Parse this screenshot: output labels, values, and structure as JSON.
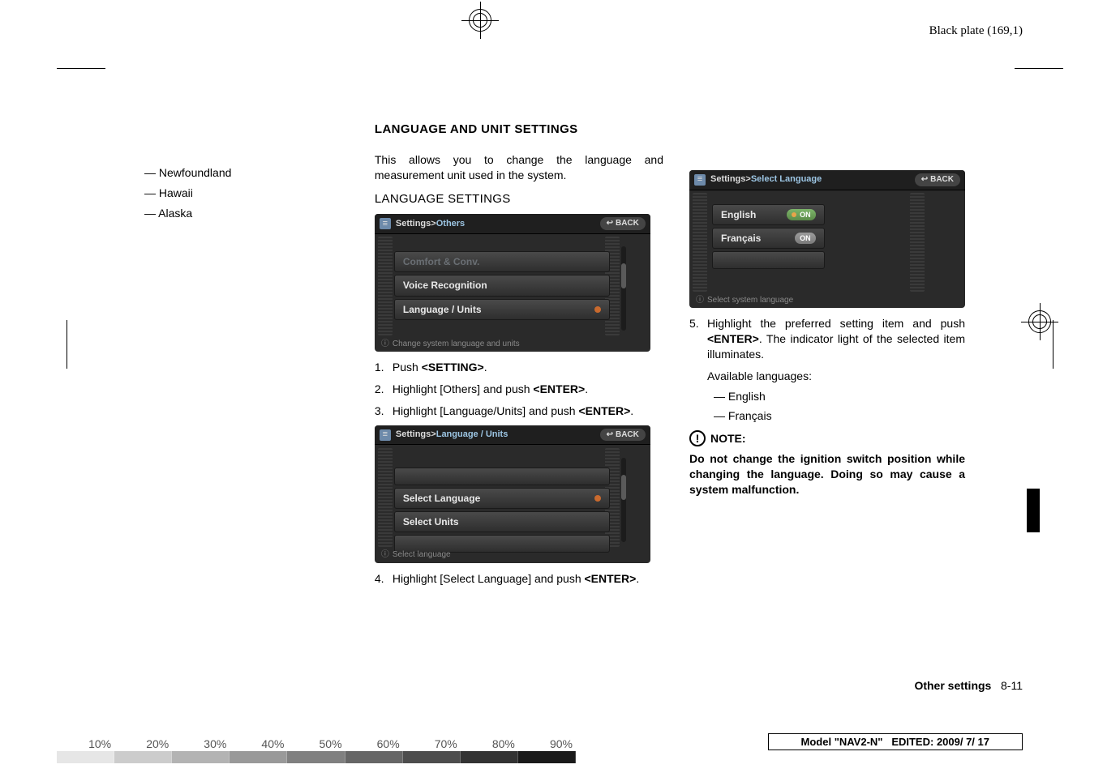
{
  "header": {
    "plate_label": "Black plate (169,1)"
  },
  "col1": {
    "regions": [
      "Newfoundland",
      "Hawaii",
      "Alaska"
    ]
  },
  "col2": {
    "section_title": "LANGUAGE AND UNIT SETTINGS",
    "intro": "This allows you to change the language and measurement unit used in the system.",
    "sub_title": "LANGUAGE SETTINGS",
    "device1": {
      "breadcrumb_root": "Settings",
      "breadcrumb_sep": " > ",
      "breadcrumb_leaf": "Others",
      "back": "BACK",
      "rows": [
        {
          "label": "Comfort & Conv.",
          "disabled": true
        },
        {
          "label": "Voice Recognition"
        },
        {
          "label": "Language / Units",
          "dot": true
        }
      ],
      "hint": "Change system language and units"
    },
    "steps_a": [
      {
        "n": "1.",
        "t_pre": "Push ",
        "t_key": "<SETTING>",
        "t_post": "."
      },
      {
        "n": "2.",
        "t_pre": "Highlight [Others] and push ",
        "t_key": "<ENTER>",
        "t_post": "."
      },
      {
        "n": "3.",
        "t_pre": "Highlight [Language/Units] and push ",
        "t_key": "<ENTER>",
        "t_post": "."
      }
    ],
    "device2": {
      "breadcrumb_root": "Settings",
      "breadcrumb_sep": " > ",
      "breadcrumb_leaf": "Language / Units",
      "back": "BACK",
      "rows": [
        {
          "label": "Select Language",
          "dot": true
        },
        {
          "label": "Select Units"
        }
      ],
      "hint": "Select language"
    },
    "step_b": {
      "n": "4.",
      "t_pre": "Highlight [Select Language] and push ",
      "t_key": "<ENTER>",
      "t_post": "."
    }
  },
  "col3": {
    "device3": {
      "breadcrumb_root": "Settings",
      "breadcrumb_sep": " > ",
      "breadcrumb_leaf": "Select Language",
      "back": "BACK",
      "rows": [
        {
          "label": "English",
          "toggle": "ON",
          "led": true
        },
        {
          "label": "Français",
          "toggle": "ON",
          "thin": true
        }
      ],
      "hint": "Select system language"
    },
    "step_c_pre": "Highlight the preferred setting item and push ",
    "step_c_key": "<ENTER>",
    "step_c_post": ". The indicator light of the selected item illuminates.",
    "step_c_num": "5.",
    "avail_label": "Available languages:",
    "avail_items": [
      "English",
      "Français"
    ],
    "note_label": "NOTE:",
    "note_body": "Do not change the ignition switch position while changing the language. Doing so may cause a system malfunction."
  },
  "footer": {
    "section": "Other settings",
    "pagenum": "8-11",
    "model_label": "Model ",
    "model_value": "\"NAV2-N\"",
    "edited_label": "EDITED: ",
    "edited_value": "2009/ 7/ 17",
    "pct": [
      "10%",
      "20%",
      "30%",
      "40%",
      "50%",
      "60%",
      "70%",
      "80%",
      "90%"
    ]
  }
}
